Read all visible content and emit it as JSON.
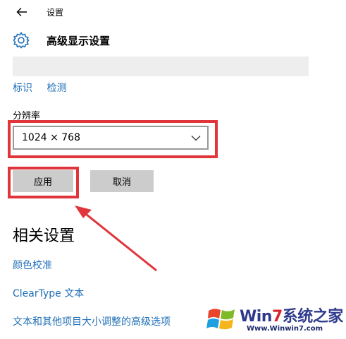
{
  "window": {
    "title": "设置"
  },
  "header": {
    "title": "高级显示设置"
  },
  "links": {
    "identify": "标识",
    "detect": "检测"
  },
  "resolution": {
    "label": "分辨率",
    "value": "1024 × 768"
  },
  "buttons": {
    "apply": "应用",
    "cancel": "取消"
  },
  "related": {
    "title": "相关设置",
    "items": [
      "颜色校准",
      "ClearType 文本",
      "文本和其他项目大小调整的高级选项"
    ]
  },
  "watermark": {
    "brand_a": "Win",
    "brand_b": "7",
    "brand_c": "系统之家",
    "url": "Www.Winwin7.com"
  },
  "colors": {
    "accent_link": "#1f6fb6",
    "highlight": "#e0353b",
    "button": "#cccccc"
  },
  "icons": {
    "back": "back-arrow-icon",
    "settings": "gear-icon",
    "dropdown": "chevron-down-icon"
  }
}
